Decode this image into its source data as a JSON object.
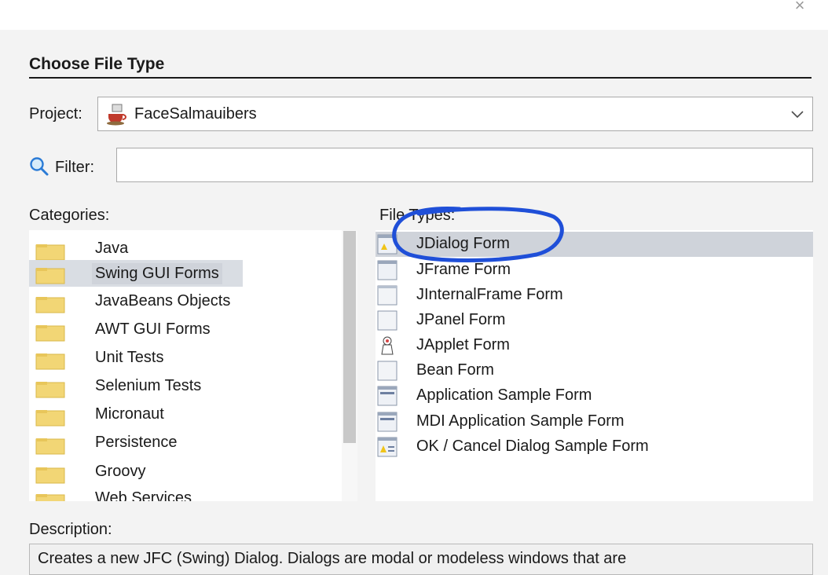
{
  "dialog": {
    "title": "Choose File Type",
    "close_icon": "close-icon"
  },
  "project": {
    "label": "Project:",
    "value": "FaceSalmauibers",
    "icon": "coffee-cup-icon"
  },
  "filter": {
    "label": "Filter:",
    "value": "",
    "placeholder": "",
    "icon": "search-icon"
  },
  "categories": {
    "label": "Categories:",
    "items": [
      {
        "label": "Java",
        "selected": false
      },
      {
        "label": "Swing GUI Forms",
        "selected": true
      },
      {
        "label": "JavaBeans Objects",
        "selected": false
      },
      {
        "label": "AWT GUI Forms",
        "selected": false
      },
      {
        "label": "Unit Tests",
        "selected": false
      },
      {
        "label": "Selenium Tests",
        "selected": false
      },
      {
        "label": "Micronaut",
        "selected": false
      },
      {
        "label": "Persistence",
        "selected": false
      },
      {
        "label": "Groovy",
        "selected": false
      },
      {
        "label": "Web Services",
        "selected": false
      }
    ]
  },
  "file_types": {
    "label": "File Types:",
    "items": [
      {
        "label": "JDialog Form",
        "selected": true,
        "icon": "dialog-form-icon"
      },
      {
        "label": "JFrame Form",
        "selected": false,
        "icon": "frame-form-icon"
      },
      {
        "label": "JInternalFrame Form",
        "selected": false,
        "icon": "internal-frame-form-icon"
      },
      {
        "label": "JPanel Form",
        "selected": false,
        "icon": "panel-form-icon"
      },
      {
        "label": "JApplet Form",
        "selected": false,
        "icon": "applet-form-icon"
      },
      {
        "label": "Bean Form",
        "selected": false,
        "icon": "bean-form-icon"
      },
      {
        "label": "Application Sample Form",
        "selected": false,
        "icon": "application-sample-form-icon"
      },
      {
        "label": "MDI Application Sample Form",
        "selected": false,
        "icon": "mdi-application-sample-form-icon"
      },
      {
        "label": "OK / Cancel Dialog Sample Form",
        "selected": false,
        "icon": "ok-cancel-dialog-sample-form-icon"
      }
    ]
  },
  "description": {
    "label": "Description:",
    "text": "Creates a new JFC (Swing) Dialog. Dialogs are modal or modeless windows that are"
  },
  "colors": {
    "selection": "#cfd3da",
    "folder": "#f2d675",
    "annotation": "#1f4fd8"
  }
}
